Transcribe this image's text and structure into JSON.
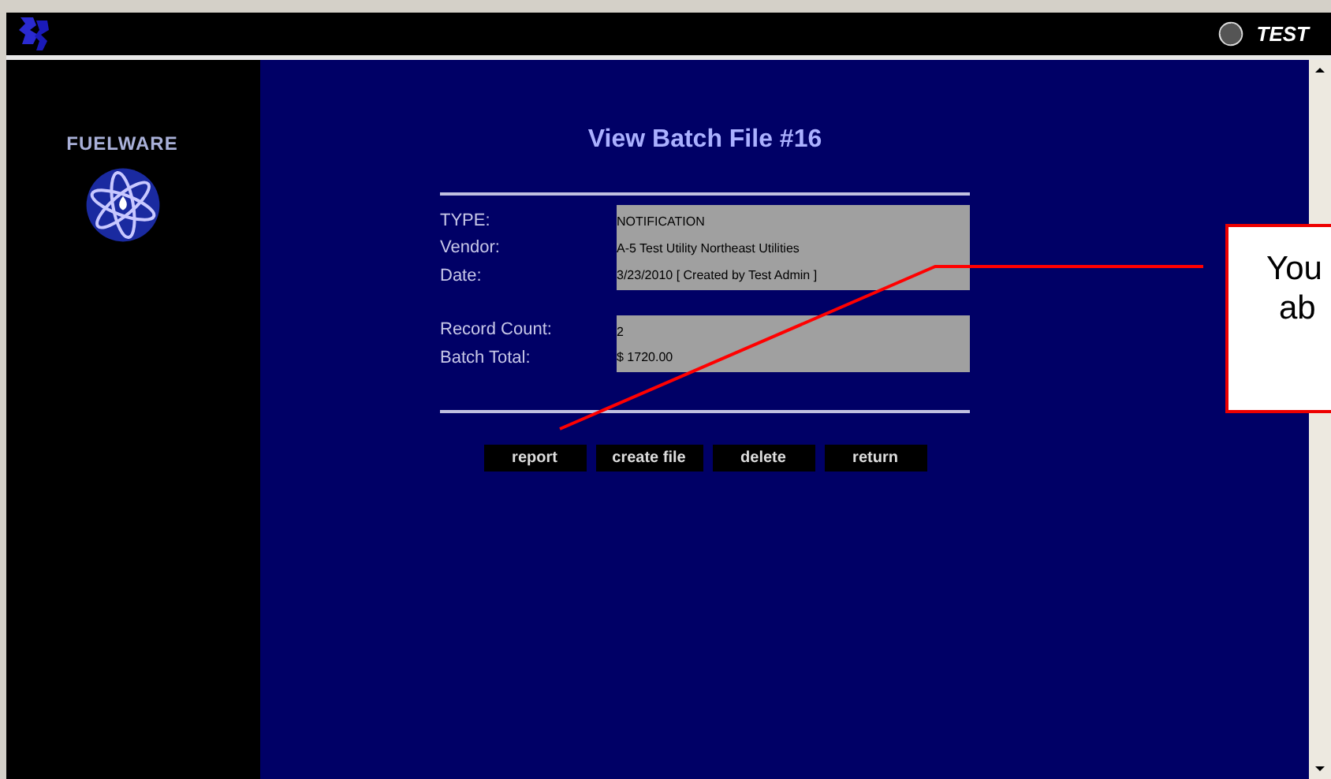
{
  "header": {
    "badge": "TEST"
  },
  "sidebar": {
    "brand": "FUELWARE"
  },
  "page": {
    "title": "View Batch File #16"
  },
  "details": [
    {
      "label": "TYPE:",
      "value": "NOTIFICATION"
    },
    {
      "label": "Vendor:",
      "value": "A-5 Test Utility Northeast Utilities"
    },
    {
      "label": "Date:",
      "value": "3/23/2010 [ Created by Test Admin ]"
    }
  ],
  "totals": [
    {
      "label": "Record Count:",
      "value": "2"
    },
    {
      "label": "Batch Total:",
      "value": "$ 1720.00"
    }
  ],
  "buttons": [
    "report",
    "create file",
    "delete",
    "return"
  ],
  "callout": {
    "lines": [
      "You",
      "ab"
    ]
  }
}
